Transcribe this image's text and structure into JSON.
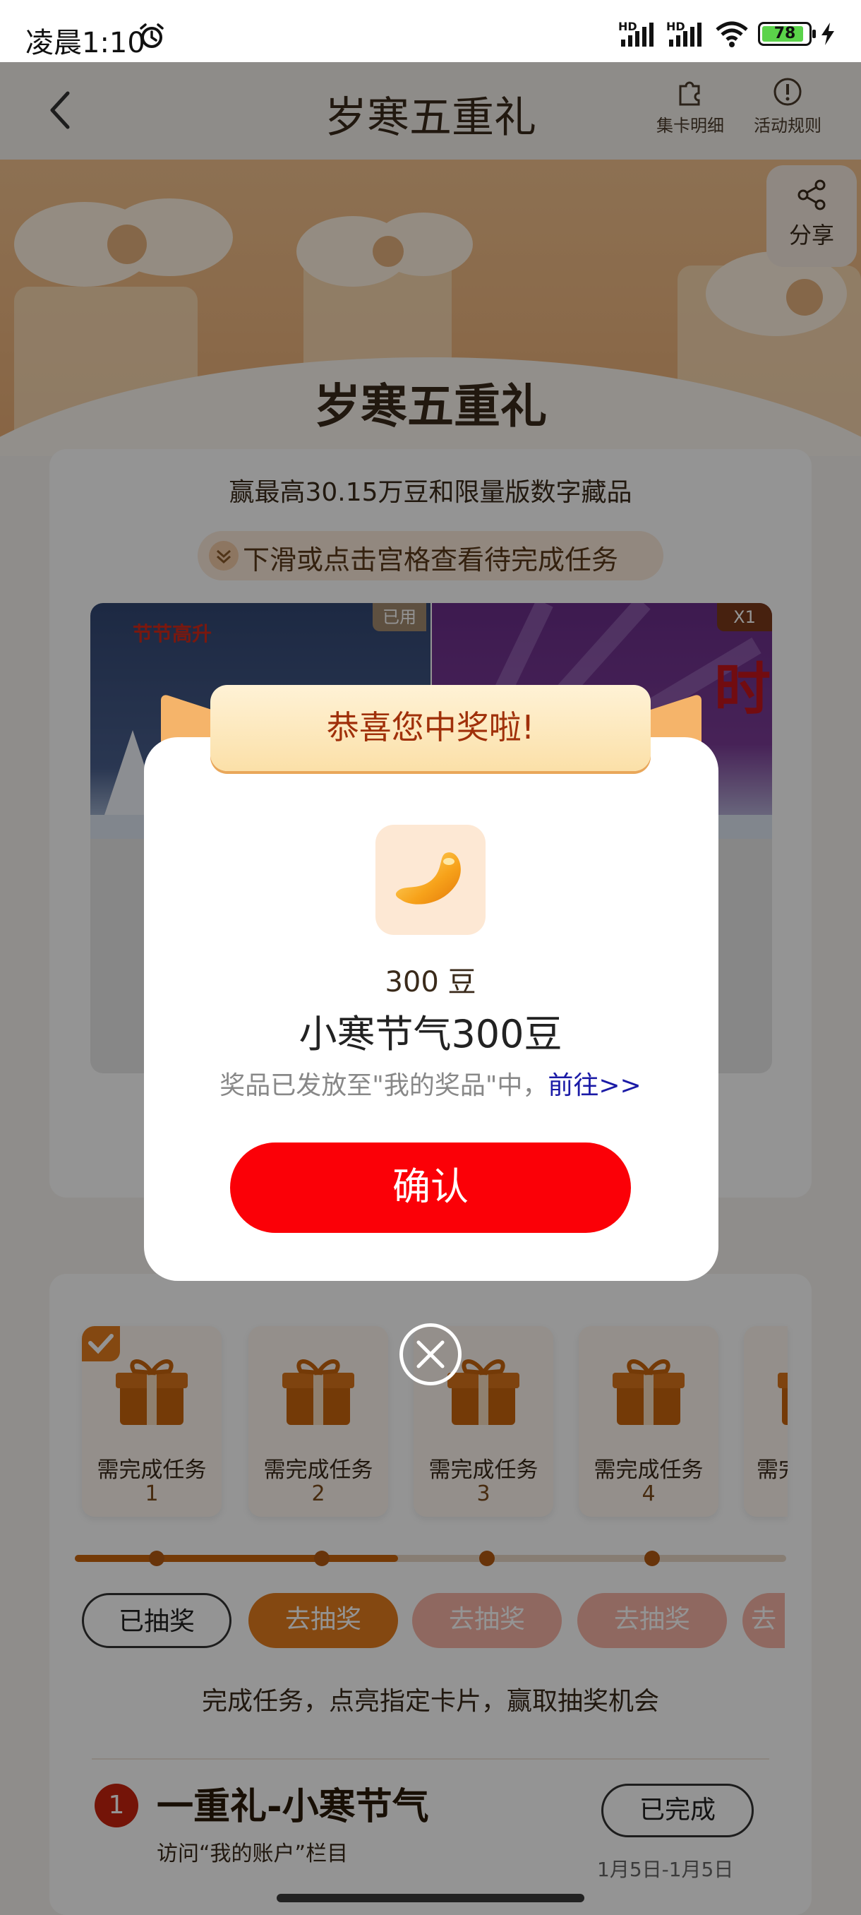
{
  "status_bar": {
    "time": "凌晨1:10",
    "battery": "78",
    "signal_label_1": "HD",
    "signal_label_2": "HD"
  },
  "header": {
    "title": "岁寒五重礼",
    "collect_detail": "集卡明细",
    "rules": "活动规则"
  },
  "banner": {
    "share": "分享",
    "title": "岁寒五重礼"
  },
  "intro": {
    "description": "赢最高30.15万豆和限量版数字藏品",
    "hint": "下滑或点击宫格查看待完成任务"
  },
  "image_panel": {
    "tag_used": "已用",
    "tag_count": "X1",
    "left_mark": "节节高升"
  },
  "tasks": {
    "cards": [
      {
        "label": "需完成任务",
        "num": "1",
        "done": true
      },
      {
        "label": "需完成任务",
        "num": "2",
        "done": false
      },
      {
        "label": "需完成任务",
        "num": "3",
        "done": false
      },
      {
        "label": "需完成任务",
        "num": "4",
        "done": false
      },
      {
        "label": "需完成任务",
        "num": "",
        "done": false
      }
    ],
    "progress": 0.375,
    "buttons": [
      "已抽奖",
      "去抽奖",
      "去抽奖",
      "去抽奖",
      "去"
    ],
    "hint": "完成任务，点亮指定卡片，赢取抽奖机会"
  },
  "task_item": {
    "index": "1",
    "title": "一重礼-小寒节气",
    "subtitle": "访问“我的账户”栏目",
    "status": "已完成",
    "date": "1月5日-1月5日"
  },
  "modal": {
    "ribbon": "恭喜您中奖啦!",
    "prize_qty": "300 豆",
    "prize_name": "小寒节气300豆",
    "note_prefix": "奖品已发放至\"我的奖品\"中，",
    "note_link": "前往>>",
    "confirm": "确认"
  },
  "colors": {
    "accent": "#fb0007",
    "brand_orange": "#e37d1e",
    "link": "#1a1aa6"
  }
}
